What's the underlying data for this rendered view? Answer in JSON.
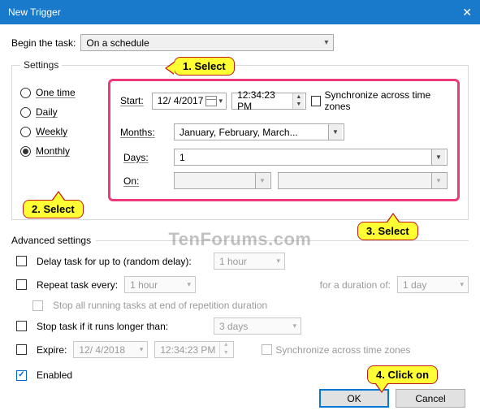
{
  "title": "New Trigger",
  "begin": {
    "label": "Begin the task:",
    "value": "On a schedule"
  },
  "settings": {
    "legend": "Settings",
    "freq": {
      "one_time": "One time",
      "daily": "Daily",
      "weekly": "Weekly",
      "monthly": "Monthly"
    },
    "start_label": "Start:",
    "start_date": "12/ 4/2017",
    "start_time": "12:34:23 PM",
    "sync_label": "Synchronize across time zones",
    "months_label": "Months:",
    "months_value": "January, February, March...",
    "days_label": "Days:",
    "days_value": "1",
    "on_label": "On:"
  },
  "advanced": {
    "legend": "Advanced settings",
    "delay_label": "Delay task for up to (random delay):",
    "delay_value": "1 hour",
    "repeat_label": "Repeat task every:",
    "repeat_value": "1 hour",
    "duration_label": "for a duration of:",
    "duration_value": "1 day",
    "stop_all_label": "Stop all running tasks at end of repetition duration",
    "stop_if_label": "Stop task if it runs longer than:",
    "stop_if_value": "3 days",
    "expire_label": "Expire:",
    "expire_date": "12/ 4/2018",
    "expire_time": "12:34:23 PM",
    "sync2_label": "Synchronize across time zones",
    "enabled_label": "Enabled"
  },
  "buttons": {
    "ok": "OK",
    "cancel": "Cancel"
  },
  "callouts": {
    "c1": "1. Select",
    "c2": "2. Select",
    "c3": "3. Select",
    "c4": "4. Click on"
  },
  "watermark": "TenForums.com"
}
